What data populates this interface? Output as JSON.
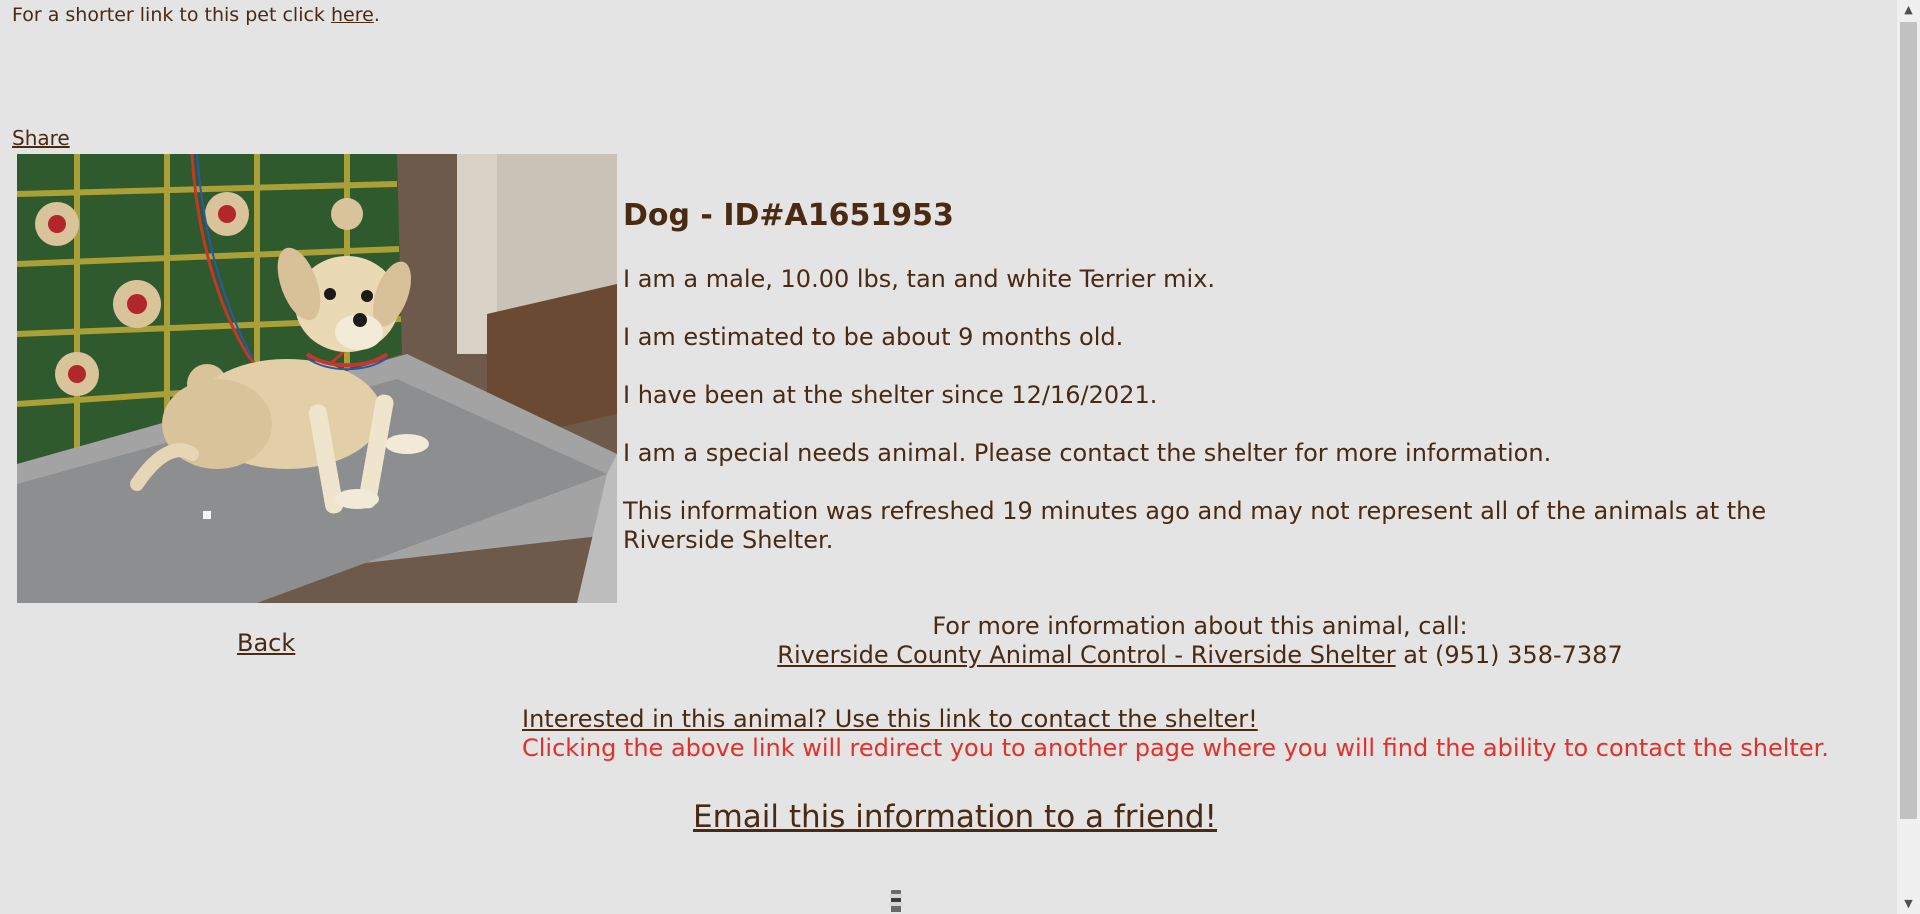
{
  "shortlink": {
    "prefix": "For a shorter link to this pet click ",
    "link_label": "here",
    "suffix": "."
  },
  "share_label": "Share",
  "animal": {
    "title": "Dog - ID#A1651953",
    "description": "I am a male, 10.00 lbs, tan and white Terrier mix.",
    "age": "I am estimated to be about 9 months old.",
    "since": "I have been at the shelter since 12/16/2021.",
    "special_needs": "I am a special needs animal. Please contact the shelter for more information.",
    "refresh_note": "This information was refreshed 19 minutes ago and may not represent all of the animals at the Riverside Shelter."
  },
  "back_label": "Back",
  "contact": {
    "prompt": "For more information about this animal, call:",
    "shelter_link": "Riverside County Animal Control - Riverside Shelter",
    "phone_text": " at (951) 358-7387"
  },
  "interest": {
    "link_label": "Interested in this animal? Use this link to contact the shelter!",
    "warning": "Clicking the above link will redirect you to another page where you will find the ability to contact the shelter."
  },
  "email_label": "Email this information to a friend!",
  "icons": {
    "scroll_up": "scroll-up-arrow-icon",
    "scroll_down": "scroll-down-arrow-icon",
    "loading": "loading-spinner-icon"
  },
  "colors": {
    "background": "#e4e4e4",
    "text": "#4a2a12",
    "warning": "#e0312a"
  }
}
